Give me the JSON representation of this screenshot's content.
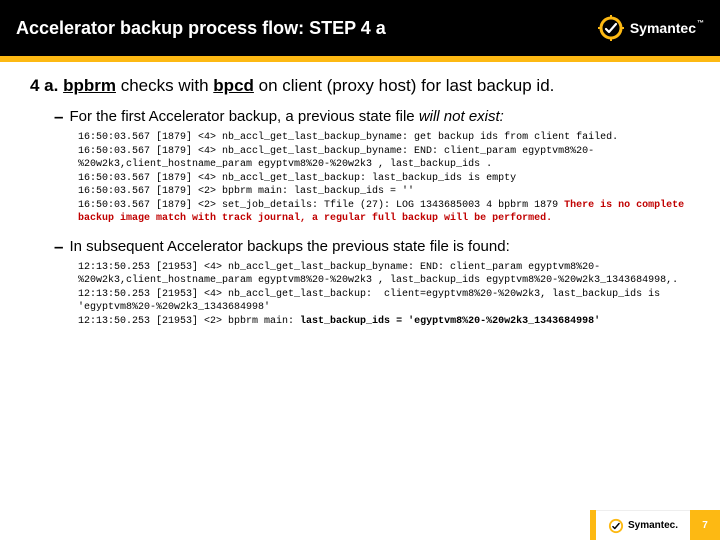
{
  "header": {
    "title": "Accelerator backup process flow: STEP 4 a",
    "brand": "Symantec",
    "reg": "™"
  },
  "step": {
    "prefix": "4 a. ",
    "b1": "bpbrm",
    "mid1": " checks with ",
    "b2": "bpcd",
    "mid2": " on client (proxy host) for last backup id."
  },
  "bullet1": {
    "dash": "–",
    "pre": "For the first Accelerator backup, a previous state file ",
    "em": "will not exist:",
    "post": ""
  },
  "log1": {
    "plain": "16:50:03.567 [1879] <4> nb_accl_get_last_backup_byname: get backup ids from client failed.\n16:50:03.567 [1879] <4> nb_accl_get_last_backup_byname: END: client_param egyptvm8%20-%20w2k3,client_hostname_param egyptvm8%20-%20w2k3 , last_backup_ids .\n16:50:03.567 [1879] <4> nb_accl_get_last_backup: last_backup_ids is empty\n16:50:03.567 [1879] <2> bpbrm main: last_backup_ids = ''\n16:50:03.567 [1879] <2> set_job_details: Tfile (27): LOG 1343685003 4 bpbrm 1879 ",
    "hl": "There is no complete backup image match with track journal, a regular full backup will be performed."
  },
  "bullet2": {
    "dash": "–",
    "text": "In subsequent Accelerator backups the previous state file is found:"
  },
  "log2": {
    "plain": "12:13:50.253 [21953] <4> nb_accl_get_last_backup_byname: END: client_param egyptvm8%20-%20w2k3,client_hostname_param egyptvm8%20-%20w2k3 , last_backup_ids egyptvm8%20-%20w2k3_1343684998,.\n12:13:50.253 [21953] <4> nb_accl_get_last_backup:  client=egyptvm8%20-%20w2k3, last_backup_ids is  'egyptvm8%20-%20w2k3_1343684998'\n12:13:50.253 [21953] <2> bpbrm main: ",
    "hl": "last_backup_ids = 'egyptvm8%20-%20w2k3_1343684998'"
  },
  "footer": {
    "brand": "Symantec.",
    "page": "7"
  }
}
